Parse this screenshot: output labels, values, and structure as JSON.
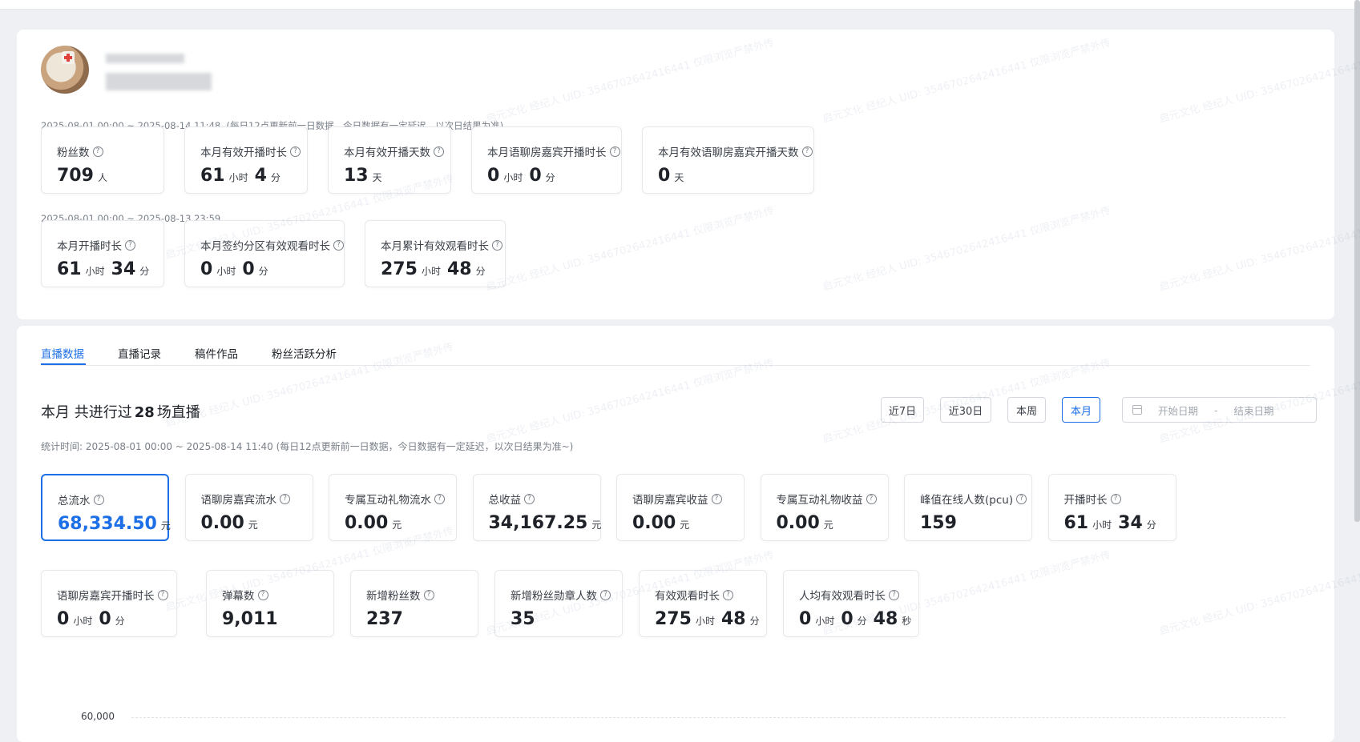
{
  "profile": {
    "range1": "2025-08-01 00:00 ~ 2025-08-14 11:48",
    "note1": "(每日12点更新前一日数据，今日数据有一定延迟，以次日结果为准)",
    "stats1": [
      {
        "label": "粉丝数",
        "parts": [
          {
            "n": "709",
            "u": "人"
          }
        ]
      },
      {
        "label": "本月有效开播时长",
        "parts": [
          {
            "n": "61",
            "u": "小时"
          },
          {
            "n": "4",
            "u": "分"
          }
        ]
      },
      {
        "label": "本月有效开播天数",
        "parts": [
          {
            "n": "13",
            "u": "天"
          }
        ]
      },
      {
        "label": "本月语聊房嘉宾开播时长",
        "parts": [
          {
            "n": "0",
            "u": "小时"
          },
          {
            "n": "0",
            "u": "分"
          }
        ]
      },
      {
        "label": "本月有效语聊房嘉宾开播天数",
        "parts": [
          {
            "n": "0",
            "u": "天"
          }
        ]
      }
    ],
    "range2": "2025-08-01 00:00 ~ 2025-08-13 23:59",
    "stats2": [
      {
        "label": "本月开播时长",
        "parts": [
          {
            "n": "61",
            "u": "小时"
          },
          {
            "n": "34",
            "u": "分"
          }
        ]
      },
      {
        "label": "本月签约分区有效观看时长",
        "parts": [
          {
            "n": "0",
            "u": "小时"
          },
          {
            "n": "0",
            "u": "分"
          }
        ]
      },
      {
        "label": "本月累计有效观看时长",
        "parts": [
          {
            "n": "275",
            "u": "小时"
          },
          {
            "n": "48",
            "u": "分"
          }
        ]
      }
    ]
  },
  "tabs": [
    "直播数据",
    "直播记录",
    "稿件作品",
    "粉丝活跃分析"
  ],
  "headline": {
    "prefix": "本月 共进行过",
    "count": "28",
    "suffix": "场直播"
  },
  "filters": {
    "buttons": [
      "近7日",
      "近30日",
      "本周",
      "本月"
    ],
    "selected": "本月",
    "start_placeholder": "开始日期",
    "sep": "-",
    "end_placeholder": "结束日期"
  },
  "stat_time": "统计时间:  2025-08-01 00:00 ~ 2025-08-14 11:40     (每日12点更新前一日数据，今日数据有一定延迟，以次日结果为准~)",
  "live_stats_row1": [
    {
      "label": "总流水",
      "parts": [
        {
          "n": "68,334.50",
          "u": "元"
        }
      ],
      "active": true
    },
    {
      "label": "语聊房嘉宾流水",
      "parts": [
        {
          "n": "0.00",
          "u": "元"
        }
      ]
    },
    {
      "label": "专属互动礼物流水",
      "parts": [
        {
          "n": "0.00",
          "u": "元"
        }
      ]
    },
    {
      "label": "总收益",
      "parts": [
        {
          "n": "34,167.25",
          "u": "元"
        }
      ]
    },
    {
      "label": "语聊房嘉宾收益",
      "parts": [
        {
          "n": "0.00",
          "u": "元"
        }
      ]
    },
    {
      "label": "专属互动礼物收益",
      "parts": [
        {
          "n": "0.00",
          "u": "元"
        }
      ]
    },
    {
      "label": "峰值在线人数(pcu)",
      "parts": [
        {
          "n": "159",
          "u": ""
        }
      ]
    },
    {
      "label": "开播时长",
      "parts": [
        {
          "n": "61",
          "u": "小时"
        },
        {
          "n": "34",
          "u": "分"
        }
      ]
    }
  ],
  "live_stats_row2": [
    {
      "label": "语聊房嘉宾开播时长",
      "parts": [
        {
          "n": "0",
          "u": "小时"
        },
        {
          "n": "0",
          "u": "分"
        }
      ]
    },
    {
      "label": "弹幕数",
      "parts": [
        {
          "n": "9,011",
          "u": ""
        }
      ]
    },
    {
      "label": "新增粉丝数",
      "parts": [
        {
          "n": "237",
          "u": ""
        }
      ]
    },
    {
      "label": "新增粉丝勋章人数",
      "parts": [
        {
          "n": "35",
          "u": ""
        }
      ]
    },
    {
      "label": "有效观看时长",
      "parts": [
        {
          "n": "275",
          "u": "小时"
        },
        {
          "n": "48",
          "u": "分"
        }
      ]
    },
    {
      "label": "人均有效观看时长",
      "parts": [
        {
          "n": "0",
          "u": "小时"
        },
        {
          "n": "0",
          "u": "分"
        },
        {
          "n": "48",
          "u": "秒"
        }
      ]
    }
  ],
  "chart": {
    "y_top_label": "60,000"
  },
  "watermark": "启元文化 经纪人 UID: 3546702642416441 仅限浏览严禁外传"
}
